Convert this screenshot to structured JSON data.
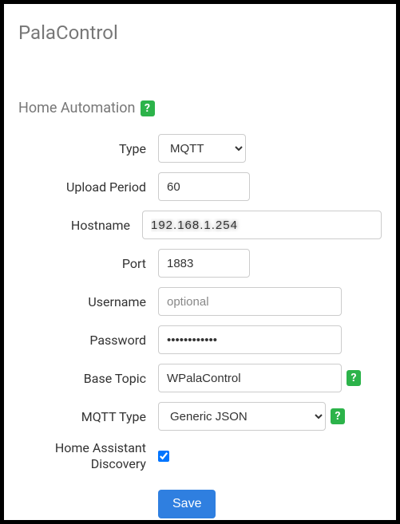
{
  "title": "PalaControl",
  "section": {
    "label": "Home Automation",
    "help_icon": "?"
  },
  "form": {
    "type": {
      "label": "Type",
      "value": "MQTT"
    },
    "upload": {
      "label": "Upload Period",
      "value": "60"
    },
    "hostname": {
      "label": "Hostname",
      "value": "192.168.1.254"
    },
    "port": {
      "label": "Port",
      "value": "1883"
    },
    "username": {
      "label": "Username",
      "placeholder": "optional",
      "value": ""
    },
    "password": {
      "label": "Password",
      "value": "••••••••••••"
    },
    "basetopic": {
      "label": "Base Topic",
      "value": "WPalaControl",
      "help_icon": "?"
    },
    "mqtt_type": {
      "label": "MQTT Type",
      "value": "Generic JSON",
      "help_icon": "?"
    },
    "discovery": {
      "label": "Home Assistant Discovery",
      "checked": true
    }
  },
  "buttons": {
    "save": "Save"
  }
}
